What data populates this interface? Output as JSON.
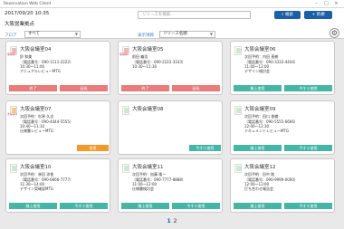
{
  "app": {
    "title": "Reservation Web Client"
  },
  "header": {
    "datetime": "2017/09/20 10:35",
    "place": "大阪営業拠点",
    "search_placeholder": "リソースを検索...",
    "search_btn": "検索",
    "new_btn": "新規",
    "filter1_label": "フロア",
    "filter1_value": "すべて",
    "filter2_label": "表示項目",
    "filter2_value": "リソース名順"
  },
  "cards": [
    {
      "room": "大阪会議室04",
      "status_color": "pink",
      "indicator": "使用中",
      "lines": [
        "鈴 和美",
        "（電話番号：090-1111-2222）",
        "10:30～11:00",
        "アニュアルレビューMTG"
      ],
      "buttons": [
        {
          "label": "終了",
          "color": "pink"
        },
        {
          "label": "延長",
          "color": "pink"
        }
      ]
    },
    {
      "room": "大阪会議室05",
      "status_color": "pink",
      "indicator": "使用中",
      "lines": [
        "前田 義浩",
        "（電話番号：090-2222-3333）",
        "10:30～11:30"
      ],
      "buttons": [
        {
          "label": "終了",
          "color": "pink"
        },
        {
          "label": "延長",
          "color": "pink"
        }
      ]
    },
    {
      "room": "大阪会議室06",
      "status_color": "green",
      "indicator": "",
      "lines": [
        "次回予約：内田 直樹",
        "（電話番号：090-3333-4444）",
        "11:00～12:00",
        "デザイン検討会"
      ],
      "buttons": [
        {
          "label": "継上使用",
          "color": "teal"
        },
        {
          "label": "今すぐ使用",
          "color": "teal"
        }
      ]
    },
    {
      "room": "大阪会議室07",
      "status_color": "orange",
      "indicator": "まもなく",
      "lines": [
        "次回予約：杉原 久志",
        "（電話番号：090-4444-5555）",
        "10:40～11:10",
        "仕様書レビューMTG"
      ],
      "buttons": [
        {
          "label": "使用",
          "color": "orange"
        }
      ]
    },
    {
      "room": "大阪会議室08",
      "status_color": "green",
      "indicator": "",
      "lines": [],
      "buttons": [
        {
          "label": "今すぐ使用",
          "color": "teal"
        }
      ]
    },
    {
      "room": "大阪会議室09",
      "status_color": "green",
      "indicator": "",
      "lines": [
        "次回予約：田口 香織",
        "（電話番号：090-5555-6666）",
        "12:00～12:30",
        "ドキュメントレビューMTG"
      ],
      "buttons": [
        {
          "label": "継上使用",
          "color": "teal"
        },
        {
          "label": "今すぐ使用",
          "color": "teal"
        }
      ]
    },
    {
      "room": "大阪会議室10",
      "status_color": "green",
      "indicator": "",
      "lines": [
        "次回予約：林田 涼香",
        "（電話番号：090-6666-7777）",
        "11:30～14:00",
        "デザイン案確認MTG"
      ],
      "buttons": [
        {
          "label": "継上使用",
          "color": "teal"
        },
        {
          "label": "今すぐ使用",
          "color": "teal"
        }
      ]
    },
    {
      "room": "大阪会議室11",
      "status_color": "green",
      "indicator": "",
      "lines": [
        "次回予約：加藤 隆一",
        "（電話番号：090-7777-8888）",
        "11:00～12:00",
        "仕様書検討会"
      ],
      "buttons": [
        {
          "label": "継上使用",
          "color": "teal"
        },
        {
          "label": "今すぐ使用",
          "color": "teal"
        }
      ]
    },
    {
      "room": "大阪会議室12",
      "status_color": "green",
      "indicator": "",
      "lines": [
        "次回予約：田中 聡",
        "（電話番号：090-9999-0000）",
        "12:00～13:00",
        "打ち合わせ報告会"
      ],
      "buttons": [
        {
          "label": "継上使用",
          "color": "teal"
        },
        {
          "label": "今すぐ使用",
          "color": "teal"
        }
      ]
    }
  ],
  "pager": {
    "current": "1",
    "next": "2"
  }
}
